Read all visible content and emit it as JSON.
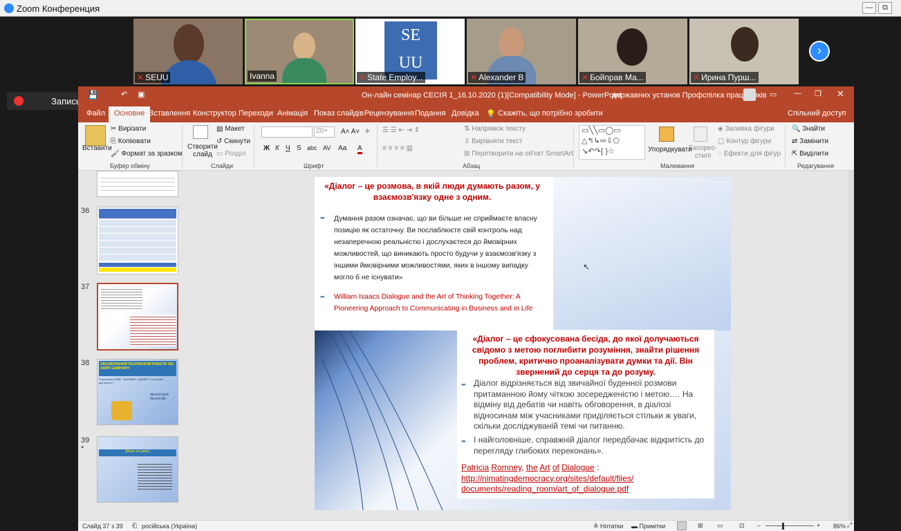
{
  "zoom": {
    "title": "Zoom Конференция",
    "record_label": "Запись...",
    "participants": [
      "SEUU",
      "Ivanna",
      "State Employ...",
      "Alexander B",
      "Бойправ Ма...",
      "Ирина Пурш..."
    ]
  },
  "ppt": {
    "title": "Он-лайн семінар СЕСІЯ 1_16.10.2020 (1)[Compatibility Mode] - PowerPoint",
    "account": "державних установ Профспілка працівників",
    "tabs": [
      "Файл",
      "Основне",
      "Вставлення",
      "Конструктор",
      "Переходи",
      "Анімація",
      "Показ слайдів",
      "Рецензування",
      "Подання",
      "Довідка",
      "Скажіть, що потрібно зробити"
    ],
    "share": "Спільний доступ",
    "ribbon": {
      "paste": "Вставити",
      "cut": "Вирізати",
      "copy": "Копіювати",
      "format_painter": "Формат за зразком",
      "clipboard": "Буфер обміну",
      "new_slide_1": "Створити",
      "new_slide_2": "слайд",
      "layout": "Макет",
      "reset": "Скинути",
      "section": "Розділ",
      "slides": "Слайди",
      "font": "Шрифт",
      "font_size": "20+",
      "text_dir": "Напрямок тексту",
      "align_text": "Вирівняти текст",
      "smartart": "Перетворити на об'єкт SmartArt",
      "paragraph": "Абзац",
      "arrange": "Упорядкувати",
      "quick_styles_1": "Експрес-",
      "quick_styles_2": "стилі",
      "fill": "Заливка фігури",
      "outline": "Контур фігури",
      "effects": "Ефекти для фігур",
      "drawing": "Малювання",
      "find": "Знайти",
      "replace": "Замінити",
      "select": "Виділити",
      "editing": "Редагування",
      "bold": "Ж",
      "italic": "К",
      "underline": "Ч",
      "strike": "S",
      "shadow": "abc",
      "spacing": "AV",
      "case": "Aa",
      "color": "A"
    },
    "thumb_numbers": [
      "36",
      "37",
      "38",
      "39"
    ],
    "thumb_star": "*",
    "slide": {
      "q1": "«Діалог – це розмова, в якій люди думають разом, у взаємозв'язку одне з одним.",
      "p1": "Думання разом означає, що ви більше не сприймаєте власну позицію як остаточну. Ви послаблюєте свій контроль над незаперечною реальністю і дослухаєтеся до ймовірних можливостей, що виникають просто будучи у взаємозв'язку з іншими ймовірними можливостями, яких в іншому випадку могло б не існувати»",
      "cite1": "William Isaacs Dialogue and the Art of Thinking Together: A Pioneering Approach to Communicating in Business and in Life",
      "q2": "«Діалог – це сфокусована бесіда, до якої долучаються свідомо з метою поглибити розуміння, знайти рішення проблем, критично проаналізувати думки та дії. Він звернений до серця та до розуму.",
      "p2": "Діалог відрізняється від звичайної буденної розмови притаманною йому чіткою зосередженістю і метою…. На відміну від дебатів чи навіть обговорення, в діалозі відносинам між учасниками приділяється стільки ж уваги, скільки досліджуваній темі чи питанню.",
      "p3": "І найголовніше, справжній діалог передбачає відкритість до перегляду глибоких переконань».",
      "cite2_a": "Patricia",
      "cite2_b": "Romney",
      "cite2_c": "the",
      "cite2_d": "Art",
      "cite2_e": "of",
      "cite2_f": "Dialogue",
      "cite2_g": ":",
      "cite2_h": "http://nimatingdemocracy.org/sites/default/files/",
      "cite2_i": "documents/",
      "cite2_j": "reading_room",
      "cite2_k": "/art_of_dialogue.pdf"
    },
    "status": {
      "slide": "Слайд 37 з 39",
      "lang": "російська (Україна)",
      "notes": "Нотатки",
      "comments": "Примітки",
      "zoom": "86%",
      "zminus": "–",
      "zplus": "+"
    },
    "mini": {
      "t38a": "ОБГОВОРЕННЯ РЕЗУЛЬТАТІВ РОБОТИ ОН-ЛАЙН СЕМІНАРУ:",
      "t38b": "Я дізнався НОВЕ, ЗАНОВНЕ, ЦІКАВЕ?? та в моїй діяльності?",
      "t38c": "decent work decent life",
      "t39a": "Дякую за увагу!"
    }
  }
}
